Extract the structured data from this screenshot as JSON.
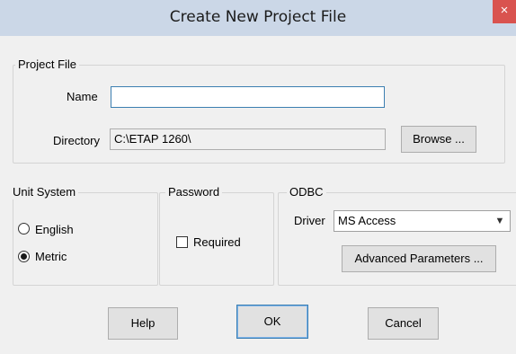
{
  "window": {
    "title": "Create New Project File",
    "close_glyph": "×"
  },
  "project_file": {
    "group_label": "Project File",
    "name_label": "Name",
    "name_value": "",
    "directory_label": "Directory",
    "directory_value": "C:\\ETAP 1260\\",
    "browse_label": "Browse ..."
  },
  "unit_system": {
    "group_label": "Unit System",
    "options": [
      {
        "label": "English",
        "selected": false
      },
      {
        "label": "Metric",
        "selected": true
      }
    ]
  },
  "password": {
    "group_label": "Password",
    "required_label": "Required",
    "required_checked": false
  },
  "odbc": {
    "group_label": "ODBC",
    "driver_label": "Driver",
    "driver_value": "MS Access",
    "advanced_label": "Advanced Parameters ..."
  },
  "buttons": {
    "help": "Help",
    "ok": "OK",
    "cancel": "Cancel"
  }
}
